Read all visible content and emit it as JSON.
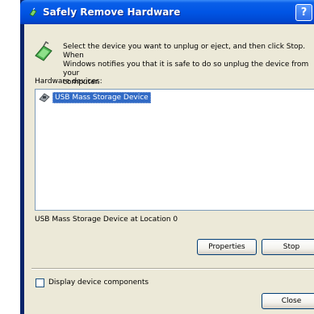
{
  "window": {
    "title": "Safely Remove Hardware",
    "help_button": "?",
    "colors": {
      "titlebar": "#0055e5",
      "client": "#ece9d8",
      "selection": "#316ac5"
    }
  },
  "instruction": "Select the device you want to unplug or eject, and then click Stop. When\nWindows notifies you that it is safe to do so unplug the device from your\ncomputer.",
  "hardware_label": "Hardware devices:",
  "devices": [
    {
      "label": "USB Mass Storage Device",
      "icon": "usb-device-icon",
      "selected": true
    }
  ],
  "location_text": "USB Mass Storage Device at Location 0",
  "buttons": {
    "properties": "Properties",
    "stop": "Stop",
    "close": "Close"
  },
  "checkbox": {
    "label": "Display device components",
    "checked": false
  }
}
